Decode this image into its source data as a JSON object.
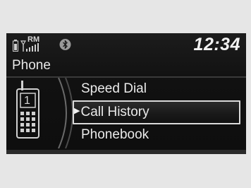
{
  "status": {
    "roaming_label": "RM",
    "time": "12:34"
  },
  "screen": {
    "title": "Phone"
  },
  "phone_display": {
    "digit": "1"
  },
  "menu": {
    "items": [
      {
        "label": "Speed Dial",
        "selected": false
      },
      {
        "label": "Call History",
        "selected": true
      },
      {
        "label": "Phonebook",
        "selected": false
      }
    ]
  },
  "colors": {
    "background": "#e6e6e6",
    "screen": "#121212",
    "text": "#eaeaea",
    "highlight_border": "#d9d9d9"
  },
  "icons": [
    "battery-icon",
    "signal-icon",
    "bluetooth-icon",
    "phone-icon",
    "selection-arrow-icon"
  ]
}
